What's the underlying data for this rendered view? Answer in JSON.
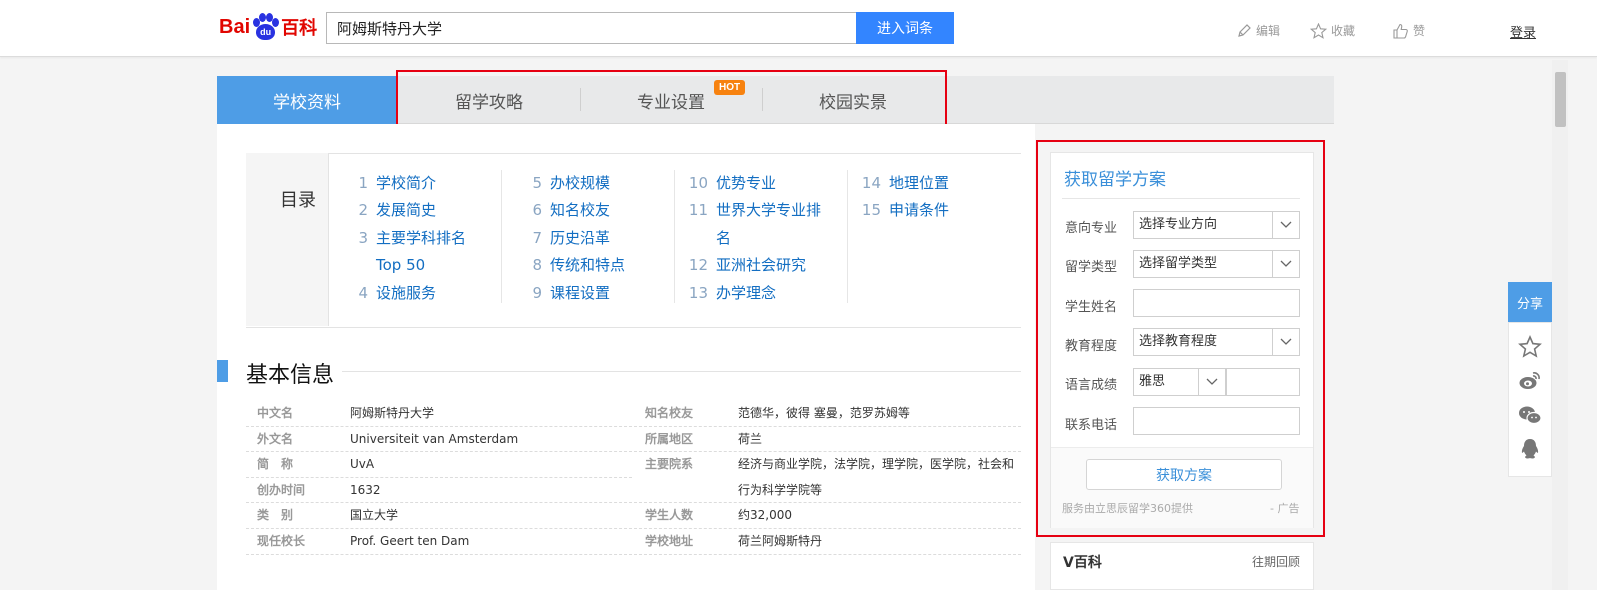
{
  "header": {
    "logo": {
      "bai": "Bai",
      "du": "du",
      "baike": "百科"
    },
    "search_value": "阿姆斯特丹大学",
    "search_button": "进入词条",
    "actions": [
      {
        "label": "编辑",
        "icon": "pencil-icon"
      },
      {
        "label": "收藏",
        "icon": "star-icon"
      },
      {
        "label": "赞",
        "icon": "thumbs-up-icon"
      }
    ],
    "login": "登录"
  },
  "tabs": {
    "active": "学校资料",
    "items": [
      "留学攻略",
      "专业设置",
      "校园实景"
    ],
    "hot_badge": "HOT"
  },
  "toc": {
    "title": "目录",
    "columns": [
      [
        {
          "num": "1",
          "text": "学校简介"
        },
        {
          "num": "2",
          "text": "发展简史"
        },
        {
          "num": "3",
          "text": "主要学科排名",
          "cont": "Top 50"
        },
        {
          "num": "4",
          "text": "设施服务"
        }
      ],
      [
        {
          "num": "5",
          "text": "办校规模"
        },
        {
          "num": "6",
          "text": "知名校友"
        },
        {
          "num": "7",
          "text": "历史沿革"
        },
        {
          "num": "8",
          "text": "传统和特点"
        },
        {
          "num": "9",
          "text": "课程设置"
        }
      ],
      [
        {
          "num": "10",
          "text": "优势专业"
        },
        {
          "num": "11",
          "text": "世界大学专业排",
          "cont": "名"
        },
        {
          "num": "12",
          "text": "亚洲社会研究"
        },
        {
          "num": "13",
          "text": "办学理念"
        }
      ],
      [
        {
          "num": "14",
          "text": "地理位置"
        },
        {
          "num": "15",
          "text": "申请条件"
        }
      ]
    ]
  },
  "basic_info": {
    "title": "基本信息",
    "left": [
      {
        "label": "中文名",
        "value": "阿姆斯特丹大学"
      },
      {
        "label": "外文名",
        "value": "Universiteit van Amsterdam"
      },
      {
        "label": "简　称",
        "value": "UvA"
      },
      {
        "label": "创办时间",
        "value": "1632"
      },
      {
        "label": "类　别",
        "value": "国立大学"
      },
      {
        "label": "现任校长",
        "value": "Prof. Geert ten Dam"
      }
    ],
    "right": [
      {
        "label": "知名校友",
        "value": "范德华，彼得 塞曼，范罗苏姆等"
      },
      {
        "label": "所属地区",
        "value": "荷兰"
      },
      {
        "label": "主要院系",
        "value": "经济与商业学院，法学院，理学院，医学院，社会和"
      },
      {
        "label": "",
        "value": "行为科学学院等"
      },
      {
        "label": "学生人数",
        "value": "约32,000"
      },
      {
        "label": "学校地址",
        "value": "荷兰阿姆斯特丹"
      }
    ]
  },
  "side_panel": {
    "title": "获取留学方案",
    "fields": [
      {
        "label": "意向专业",
        "value": "选择专业方向",
        "type": "select"
      },
      {
        "label": "留学类型",
        "value": "选择留学类型",
        "type": "select"
      },
      {
        "label": "学生姓名",
        "value": "",
        "type": "input"
      },
      {
        "label": "教育程度",
        "value": "选择教育程度",
        "type": "select"
      },
      {
        "label": "语言成绩",
        "value": "雅思",
        "type": "split"
      },
      {
        "label": "联系电话",
        "value": "",
        "type": "input"
      }
    ],
    "button": "获取方案",
    "note": "服务由立思辰留学360提供",
    "ad": "- 广告"
  },
  "vbaike": {
    "title": "V百科",
    "more": "往期回顾"
  },
  "share": {
    "label": "分享",
    "icons": [
      "star-icon",
      "weibo-icon",
      "wechat-icon",
      "qq-icon"
    ]
  },
  "colors": {
    "accent": "#4e9de6",
    "link": "#136ec2",
    "highlight": "#e60012",
    "hot": "#f7820f"
  }
}
